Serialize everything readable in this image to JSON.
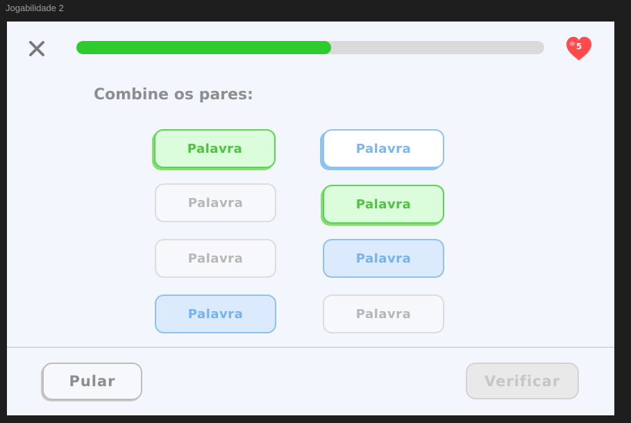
{
  "frame": {
    "label": "Jogabilidade 2"
  },
  "header": {
    "close_icon": "close-icon",
    "progress": 0.545,
    "progress_color": "#2dcb2d",
    "progress_track_color": "#dadada",
    "hearts_icon": "heart-icon",
    "hearts_count": "5",
    "hearts_color": "#ff4b4b"
  },
  "prompt": "Combine os pares:",
  "cards": [
    {
      "label": "Palavra",
      "state": "matched-green"
    },
    {
      "label": "Palavra",
      "state": "selected-blue"
    },
    {
      "label": "Palavra",
      "state": "neutral"
    },
    {
      "label": "Palavra",
      "state": "matched-green"
    },
    {
      "label": "Palavra",
      "state": "neutral"
    },
    {
      "label": "Palavra",
      "state": "highlighted-blue"
    },
    {
      "label": "Palavra",
      "state": "highlighted-blue"
    },
    {
      "label": "Palavra",
      "state": "neutral"
    }
  ],
  "footer": {
    "skip_label": "Pular",
    "verify_label": "Verificar"
  }
}
